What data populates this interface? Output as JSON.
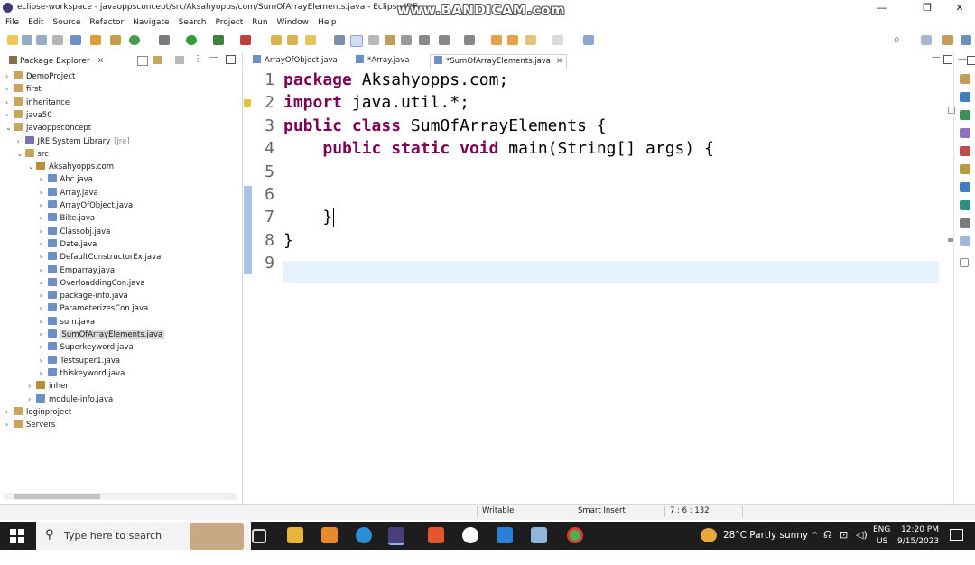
{
  "window": {
    "title": "eclipse-workspace - javaoppsconcept/src/Aksahyopps/com/SumOfArrayElements.java - Eclipse IDE",
    "watermark": "www.BANDICAM.com",
    "minimize": "—",
    "restore": "❐",
    "close": "✕"
  },
  "menu": [
    "File",
    "Edit",
    "Source",
    "Refactor",
    "Navigate",
    "Search",
    "Project",
    "Run",
    "Window",
    "Help"
  ],
  "package_explorer": {
    "tab_label": "Package Explorer",
    "tree": [
      {
        "label": "DemoProject",
        "level": 0,
        "twisty": "›",
        "icon": "project-icon"
      },
      {
        "label": "first",
        "level": 0,
        "twisty": "›",
        "icon": "project-icon"
      },
      {
        "label": "inheritance",
        "level": 0,
        "twisty": "›",
        "icon": "project-icon"
      },
      {
        "label": "java50",
        "level": 0,
        "twisty": "›",
        "icon": "project-icon"
      },
      {
        "label": "javaoppsconcept",
        "level": 0,
        "twisty": "⌄",
        "icon": "project-icon"
      },
      {
        "label": "JRE System Library",
        "suffix": "[jre]",
        "level": 1,
        "twisty": "›",
        "icon": "library-icon"
      },
      {
        "label": "src",
        "level": 1,
        "twisty": "⌄",
        "icon": "source-folder-icon"
      },
      {
        "label": "Aksahyopps.com",
        "level": 2,
        "twisty": "⌄",
        "icon": "package-icon"
      },
      {
        "label": "Abc.java",
        "level": 3,
        "twisty": "›",
        "icon": "java-file-icon"
      },
      {
        "label": "Array.java",
        "level": 3,
        "twisty": "›",
        "icon": "java-file-icon"
      },
      {
        "label": "ArrayOfObject.java",
        "level": 3,
        "twisty": "›",
        "icon": "java-file-icon"
      },
      {
        "label": "Bike.java",
        "level": 3,
        "twisty": "›",
        "icon": "java-file-icon"
      },
      {
        "label": "Classobj.java",
        "level": 3,
        "twisty": "›",
        "icon": "java-file-icon"
      },
      {
        "label": "Date.java",
        "level": 3,
        "twisty": "›",
        "icon": "java-file-icon"
      },
      {
        "label": "DefaultConstructorEx.java",
        "level": 3,
        "twisty": "›",
        "icon": "java-file-icon"
      },
      {
        "label": "Emparray.java",
        "level": 3,
        "twisty": "›",
        "icon": "java-file-icon"
      },
      {
        "label": "OverloaddingCon.java",
        "level": 3,
        "twisty": "›",
        "icon": "java-file-icon"
      },
      {
        "label": "package-info.java",
        "level": 3,
        "twisty": "›",
        "icon": "java-file-icon"
      },
      {
        "label": "ParameterizesCon.java",
        "level": 3,
        "twisty": "›",
        "icon": "java-file-icon"
      },
      {
        "label": "sum.java",
        "level": 3,
        "twisty": "›",
        "icon": "java-file-icon"
      },
      {
        "label": "SumOfArrayElements.java",
        "level": 3,
        "twisty": "›",
        "icon": "java-file-icon",
        "selected": true
      },
      {
        "label": "Superkeyword.java",
        "level": 3,
        "twisty": "›",
        "icon": "java-file-icon"
      },
      {
        "label": "Testsuper1.java",
        "level": 3,
        "twisty": "›",
        "icon": "java-file-icon"
      },
      {
        "label": "thiskeyword.java",
        "level": 3,
        "twisty": "›",
        "icon": "java-file-icon"
      },
      {
        "label": "inher",
        "level": 2,
        "twisty": "›",
        "icon": "package-icon"
      },
      {
        "label": "module-info.java",
        "level": 2,
        "twisty": "›",
        "icon": "java-file-icon"
      },
      {
        "label": "loginproject",
        "level": 0,
        "twisty": "›",
        "icon": "project-icon"
      },
      {
        "label": "Servers",
        "level": 0,
        "twisty": "›",
        "icon": "folder-icon"
      }
    ]
  },
  "editor": {
    "tabs": [
      {
        "label": "ArrayOfObject.java",
        "active": false
      },
      {
        "label": "*Array.java",
        "active": false
      },
      {
        "label": "*SumOfArrayElements.java",
        "active": true
      }
    ],
    "lines": [
      {
        "n": "1",
        "parts": [
          [
            "kw",
            "package"
          ],
          [
            "t",
            " Aksahyopps.com;"
          ]
        ]
      },
      {
        "n": "2",
        "parts": [
          [
            "kw",
            "import"
          ],
          [
            "t",
            " java.util.*;"
          ]
        ]
      },
      {
        "n": "3",
        "parts": [
          [
            "kw",
            "public"
          ],
          [
            "t",
            " "
          ],
          [
            "kw",
            "class"
          ],
          [
            "t",
            " SumOfArrayElements {"
          ]
        ]
      },
      {
        "n": "4",
        "parts": [
          [
            "t",
            "    "
          ],
          [
            "kw",
            "public"
          ],
          [
            "t",
            " "
          ],
          [
            "kw",
            "static"
          ],
          [
            "t",
            " "
          ],
          [
            "kw",
            "void"
          ],
          [
            "t",
            " main(String[] args) {"
          ]
        ]
      },
      {
        "n": "5",
        "parts": [
          [
            "t",
            ""
          ]
        ]
      },
      {
        "n": "6",
        "parts": [
          [
            "t",
            ""
          ]
        ]
      },
      {
        "n": "7",
        "parts": [
          [
            "t",
            "    }"
          ]
        ]
      },
      {
        "n": "8",
        "parts": [
          [
            "t",
            "}"
          ]
        ]
      },
      {
        "n": "9",
        "parts": [
          [
            "t",
            ""
          ]
        ]
      }
    ]
  },
  "status": {
    "writable": "Writable",
    "insert_mode": "Smart Insert",
    "position": "7 : 6 : 132"
  },
  "taskbar": {
    "search_placeholder": "Type here to search",
    "weather": "28°C  Partly sunny",
    "lang_top": "ENG",
    "lang_bottom": "US",
    "time": "12:20 PM",
    "date": "9/15/2023"
  }
}
